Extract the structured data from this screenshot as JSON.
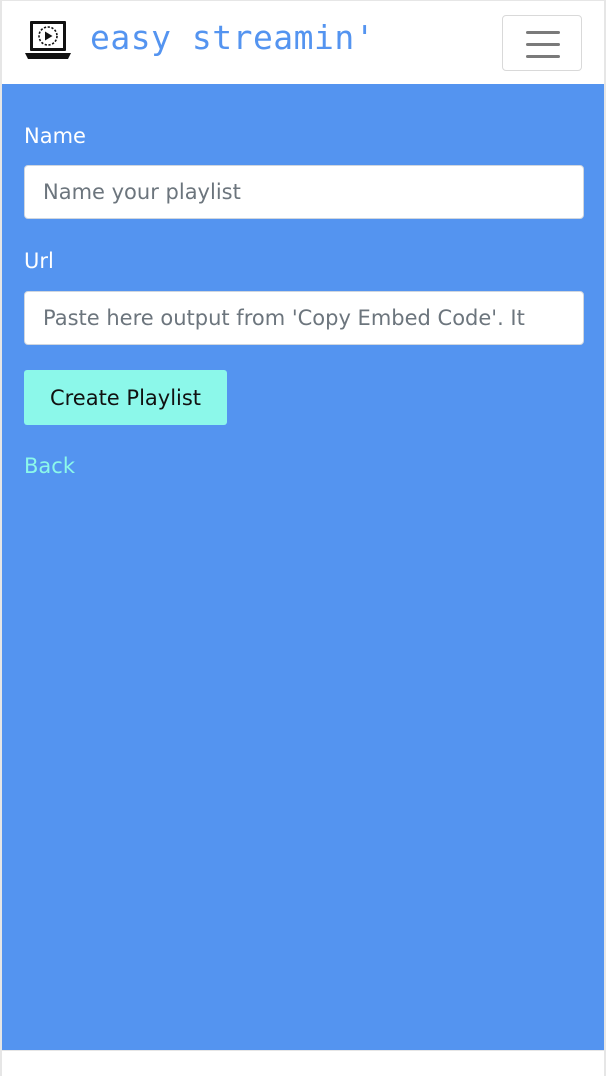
{
  "brand": {
    "logo_icon": "laptop-play-icon",
    "name": "easy streamin'",
    "color": "#5494f0"
  },
  "navbar": {
    "toggler_icon": "hamburger-menu-icon"
  },
  "form": {
    "name_label": "Name",
    "name_placeholder": "Name your playlist",
    "name_value": "",
    "url_label": "Url",
    "url_placeholder": "Paste here output from 'Copy Embed Code'. It",
    "url_value": "",
    "submit_label": "Create Playlist",
    "back_label": "Back"
  },
  "colors": {
    "background": "#5494f0",
    "accent": "#8cf8ea",
    "text": "#ffffff"
  }
}
